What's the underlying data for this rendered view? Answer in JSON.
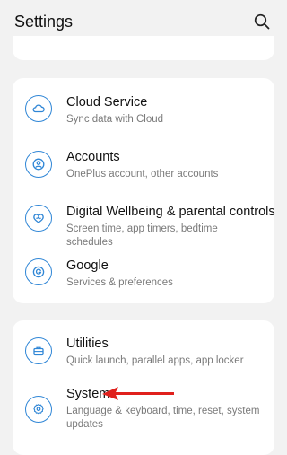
{
  "header": {
    "title": "Settings",
    "search_icon": "search-icon"
  },
  "accent_color": "#2f86d6",
  "annotation_color": "#e0201c",
  "groups": [
    {
      "items": [
        {
          "title": "Cloud Service",
          "subtitle": "Sync data with Cloud",
          "icon": "cloud-icon"
        },
        {
          "title": "Accounts",
          "subtitle": "OnePlus account, other accounts",
          "icon": "account-icon"
        },
        {
          "title": "Digital Wellbeing & parental controls",
          "subtitle": "Screen time, app timers, bedtime schedules",
          "icon": "wellbeing-heart-icon"
        },
        {
          "title": "Google",
          "subtitle": "Services & preferences",
          "icon": "google-icon"
        }
      ]
    },
    {
      "items": [
        {
          "title": "Utilities",
          "subtitle": "Quick launch, parallel apps, app locker",
          "icon": "briefcase-icon"
        },
        {
          "title": "System",
          "subtitle": "Language & keyboard, time, reset, system updates",
          "icon": "gear-icon"
        }
      ]
    }
  ]
}
